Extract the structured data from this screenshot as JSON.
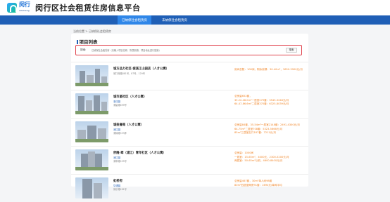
{
  "header": {
    "logo_text": "闵行",
    "logo_sub": "minhang",
    "title": "闵行区社会租赁住房信息平台"
  },
  "nav": {
    "tabs": [
      {
        "label": "已纳保社会租赁房",
        "active": true
      },
      {
        "label": "未纳保社会租赁房",
        "active": false
      }
    ]
  },
  "breadcrumb": "当前位置 > 已纳保社会租赁房",
  "section_title": "项目列表",
  "search": {
    "label": "搜索:",
    "placeholder": "已纳保社会租赁房（请输入项目名称、所属街镇、项目地址进行搜索）",
    "button": "搜索"
  },
  "projects": [
    {
      "name": "城方品力社区·城溪江山园店（人才公寓）",
      "tag": "",
      "sub": "城口南路881号、87号、129号",
      "info": [
        "房间总数：108间，剩余房源：30-40m²，3650-3900元/月"
      ]
    },
    {
      "name": "城市星社区（人才公寓）",
      "tag": "莘庄镇",
      "sub": "浦星路899号",
      "info": [
        "总房量652套，",
        "35.22-46.0m²一居室279套：3545-3248元/月",
        "64.47-86.6m²二居室370套：6325-8039元/月"
      ]
    },
    {
      "name": "城投睿南（人才公寓）",
      "tag": "浦江镇",
      "sub": "浦锦路333弄",
      "info": [
        "总房量84套，35-54m²一居室2148套：2491-4300元/月",
        "64-75m²二居室708套：5323-5666元/月",
        "85m²三居室五口187套：7211元/月"
      ]
    },
    {
      "name": "侨隆·翠（浦江）青年社区（人才公寓）",
      "tag": "浦江镇",
      "sub": "浦申路555号",
      "info": [
        "总房量：1000间",
        "一居室：15-65m²，4000元，2300-5200元/月",
        "两居室：50-65m²以前，4600-8400元/月"
      ]
    },
    {
      "name": "虹桥府",
      "tag": "华漕镇",
      "sub": "保乐路261号",
      "info": [
        "总房量467套，30m²单人间98套",
        "80m²四居室两房91套：1694元/单间平均"
      ]
    }
  ],
  "colors": {
    "nav_bg": "#1f5fb6",
    "nav_active": "#2f86e8",
    "price_text": "#f0862a",
    "search_border": "#e0444e"
  }
}
